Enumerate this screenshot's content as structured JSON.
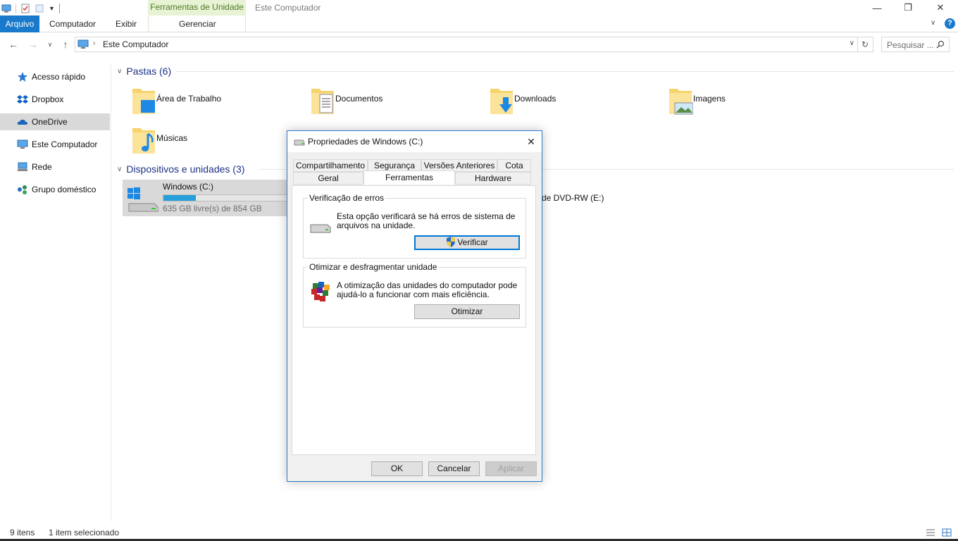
{
  "window": {
    "title": "Este Computador",
    "context_tab": "Ferramentas de Unidade",
    "controls": {
      "minimize": "—",
      "restore": "❐",
      "close": "✕"
    }
  },
  "ribbon": {
    "tabs": [
      "Arquivo",
      "Computador",
      "Exibir",
      "Gerenciar"
    ],
    "help": "?"
  },
  "nav": {
    "address": "Este Computador",
    "search_placeholder": "Pesquisar ..."
  },
  "sidebar": {
    "items": [
      {
        "label": "Acesso rápido",
        "icon": "star-icon",
        "color": "#2a78d0"
      },
      {
        "label": "Dropbox",
        "icon": "dropbox-icon",
        "color": "#0a60c8"
      },
      {
        "label": "OneDrive",
        "icon": "cloud-icon",
        "color": "#1a66b8",
        "selected": true
      },
      {
        "label": "Este Computador",
        "icon": "computer-icon",
        "color": "#3b8fd9"
      },
      {
        "label": "Rede",
        "icon": "network-icon",
        "color": "#3b8fd9"
      },
      {
        "label": "Grupo doméstico",
        "icon": "homegroup-icon",
        "color": "#2e8b57"
      }
    ]
  },
  "content": {
    "folders_header": "Pastas (6)",
    "folders": [
      {
        "name": "Área de Trabalho",
        "icon": "desktop-folder-icon"
      },
      {
        "name": "Documentos",
        "icon": "documents-folder-icon"
      },
      {
        "name": "Downloads",
        "icon": "downloads-folder-icon"
      },
      {
        "name": "Imagens",
        "icon": "pictures-folder-icon"
      },
      {
        "name": "Músicas",
        "icon": "music-folder-icon"
      }
    ],
    "devices_header": "Dispositivos e unidades (3)",
    "drive_c": {
      "name": "Windows (C:)",
      "free_text": "635 GB livre(s) de 854 GB",
      "used_fraction": 0.256
    },
    "dvd_label": "de DVD-RW (E:)"
  },
  "status": {
    "items_count": "9 itens",
    "selected": "1 item selecionado"
  },
  "dialog": {
    "title": "Propriedades de Windows (C:)",
    "tabs_row1": [
      "Compartilhamento",
      "Segurança",
      "Versões Anteriores",
      "Cota"
    ],
    "tabs_row2": [
      "Geral",
      "Ferramentas",
      "Hardware"
    ],
    "active_tab": "Ferramentas",
    "error_check": {
      "title": "Verificação de erros",
      "text": "Esta opção verificará se há erros de sistema de arquivos na unidade.",
      "button": "Verificar"
    },
    "optimize": {
      "title": "Otimizar e desfragmentar unidade",
      "text": "A otimização das unidades do computador pode ajudá-lo a funcionar com mais eficiência.",
      "button": "Otimizar"
    },
    "buttons": {
      "ok": "OK",
      "cancel": "Cancelar",
      "apply": "Aplicar"
    }
  }
}
